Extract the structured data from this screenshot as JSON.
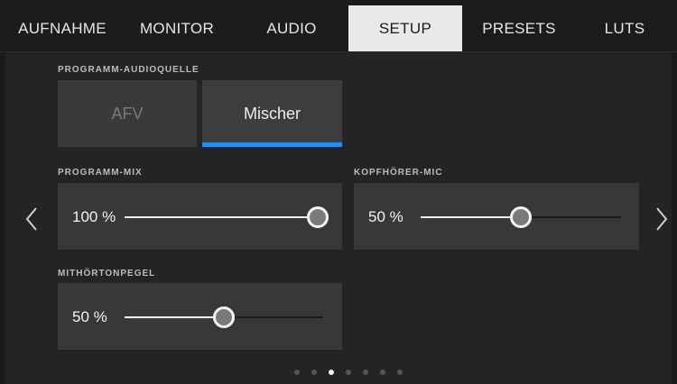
{
  "tabs": [
    {
      "label": "AUFNAHME"
    },
    {
      "label": "MONITOR"
    },
    {
      "label": "AUDIO"
    },
    {
      "label": "SETUP"
    },
    {
      "label": "PRESETS"
    },
    {
      "label": "LUTS"
    }
  ],
  "active_tab": "SETUP",
  "program_audio_source": {
    "label": "PROGRAMM-AUDIOQUELLE",
    "options": [
      {
        "label": "AFV",
        "selected": false
      },
      {
        "label": "Mischer",
        "selected": true
      }
    ]
  },
  "program_mix": {
    "label": "PROGRAMM-MIX",
    "value_text": "100 %",
    "value": 100
  },
  "headphone_mic": {
    "label": "KOPFHÖRER-MIC",
    "value_text": "50 %",
    "value": 50
  },
  "sidetone_level": {
    "label": "MITHÖRTONPEGEL",
    "value_text": "50 %",
    "value": 50
  },
  "pagination": {
    "pages": 7,
    "current": 3
  },
  "icons": {
    "prev": "chevron-left-icon",
    "next": "chevron-right-icon"
  },
  "colors": {
    "accent": "#2a8bf2",
    "active_tab_bg": "#e9e9e9"
  }
}
